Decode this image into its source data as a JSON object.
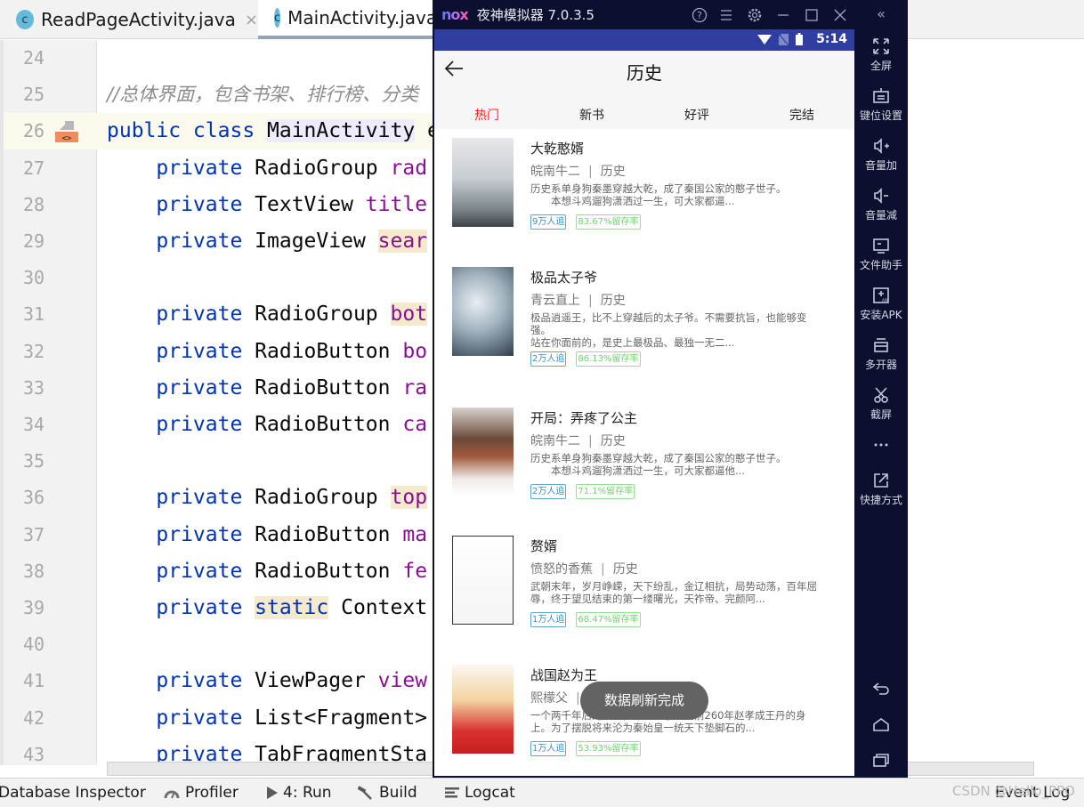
{
  "ide": {
    "tabs": [
      {
        "label": "ReadPageActivity.java",
        "icon": "class-c-icon",
        "active": false,
        "close": "×"
      },
      {
        "label": "MainActivity.java",
        "icon": "class-c-icon",
        "active": true
      }
    ],
    "code_lines": [
      {
        "num": "24",
        "segments": []
      },
      {
        "num": "25",
        "segments": [
          {
            "t": "//总体界面，包含书架、排行榜、分类",
            "c": "cmt"
          }
        ]
      },
      {
        "num": "26",
        "segments": [
          {
            "t": "public class ",
            "c": "kw"
          },
          {
            "t": "MainActivity",
            "c": "hl-lav"
          },
          {
            "t": " e",
            "c": ""
          }
        ]
      },
      {
        "num": "27",
        "segments": [
          {
            "t": "    private ",
            "c": "kw"
          },
          {
            "t": "RadioGroup ",
            "c": ""
          },
          {
            "t": "rad",
            "c": "fld"
          }
        ]
      },
      {
        "num": "28",
        "segments": [
          {
            "t": "    private ",
            "c": "kw"
          },
          {
            "t": "TextView ",
            "c": ""
          },
          {
            "t": "title",
            "c": "fld"
          }
        ]
      },
      {
        "num": "29",
        "segments": [
          {
            "t": "    private ",
            "c": "kw"
          },
          {
            "t": "ImageView ",
            "c": ""
          },
          {
            "t": "sear",
            "c": "fld hl-yellow"
          }
        ]
      },
      {
        "num": "30",
        "segments": []
      },
      {
        "num": "31",
        "segments": [
          {
            "t": "    private ",
            "c": "kw"
          },
          {
            "t": "RadioGroup ",
            "c": ""
          },
          {
            "t": "bot",
            "c": "fld hl-yellow"
          }
        ]
      },
      {
        "num": "32",
        "segments": [
          {
            "t": "    private ",
            "c": "kw"
          },
          {
            "t": "RadioButton ",
            "c": ""
          },
          {
            "t": "bo",
            "c": "fld"
          }
        ]
      },
      {
        "num": "33",
        "segments": [
          {
            "t": "    private ",
            "c": "kw"
          },
          {
            "t": "RadioButton ",
            "c": ""
          },
          {
            "t": "ra",
            "c": "fld"
          }
        ]
      },
      {
        "num": "34",
        "segments": [
          {
            "t": "    private ",
            "c": "kw"
          },
          {
            "t": "RadioButton ",
            "c": ""
          },
          {
            "t": "ca",
            "c": "fld"
          }
        ]
      },
      {
        "num": "35",
        "segments": []
      },
      {
        "num": "36",
        "segments": [
          {
            "t": "    private ",
            "c": "kw"
          },
          {
            "t": "RadioGroup ",
            "c": ""
          },
          {
            "t": "top",
            "c": "fld hl-yellow"
          }
        ]
      },
      {
        "num": "37",
        "segments": [
          {
            "t": "    private ",
            "c": "kw"
          },
          {
            "t": "RadioButton ",
            "c": ""
          },
          {
            "t": "ma",
            "c": "fld"
          }
        ]
      },
      {
        "num": "38",
        "segments": [
          {
            "t": "    private ",
            "c": "kw"
          },
          {
            "t": "RadioButton ",
            "c": ""
          },
          {
            "t": "fe",
            "c": "fld"
          }
        ]
      },
      {
        "num": "39",
        "segments": [
          {
            "t": "    private ",
            "c": "kw"
          },
          {
            "t": "static",
            "c": "kw hl-yellow"
          },
          {
            "t": " Context",
            "c": ""
          }
        ]
      },
      {
        "num": "40",
        "segments": []
      },
      {
        "num": "41",
        "segments": [
          {
            "t": "    private ",
            "c": "kw"
          },
          {
            "t": "ViewPager ",
            "c": ""
          },
          {
            "t": "view",
            "c": "fld"
          }
        ]
      },
      {
        "num": "42",
        "segments": [
          {
            "t": "    private ",
            "c": "kw"
          },
          {
            "t": "List<Fragment>",
            "c": ""
          }
        ]
      },
      {
        "num": "43",
        "segments": [
          {
            "t": "    private ",
            "c": "kw"
          },
          {
            "t": "TabFragmentSta",
            "c": ""
          }
        ]
      }
    ],
    "statusbar": {
      "items": [
        {
          "label": "Database Inspector",
          "icon": ""
        },
        {
          "label": "Profiler",
          "icon": "gauge-icon"
        },
        {
          "label": "4: Run",
          "icon": "play-icon"
        },
        {
          "label": "Build",
          "icon": "hammer-icon"
        },
        {
          "label": "Logcat",
          "icon": "logcat-icon"
        }
      ],
      "event_log": "Event Log",
      "watermark": "CSDN @Hello_PPO"
    }
  },
  "emulator": {
    "title": "夜神模拟器 7.0.3.5",
    "logo": "nox",
    "window_controls": [
      "help-icon",
      "menu-icon",
      "settings-icon",
      "minimize-icon",
      "maximize-icon",
      "close-icon"
    ],
    "status_time": "5:14",
    "app": {
      "title": "历史",
      "tabs": [
        {
          "label": "热门",
          "active": true
        },
        {
          "label": "新书",
          "active": false
        },
        {
          "label": "好评",
          "active": false
        },
        {
          "label": "完结",
          "active": false
        }
      ],
      "accent_color": "#ff2222",
      "books": [
        {
          "title": "大乾憨婿",
          "author": "皖南牛二",
          "category": "历史",
          "sep": "|",
          "desc": "历史系单身狗秦墨穿越大乾，成了秦国公家的憨子世子。\n　　本想斗鸡遛狗潇洒过一生，可大家都逼...",
          "followers": "9万人追",
          "retention": "83.67%留存率"
        },
        {
          "title": "极品太子爷",
          "author": "青云直上",
          "category": "历史",
          "sep": "|",
          "desc": "极品逍遥王，比不上穿越后的太子爷。不需要抗旨，也能够变强。\n站在你面前的，是史上最极品、最独一无二...",
          "followers": "2万人追",
          "retention": "86.13%留存率"
        },
        {
          "title": "开局：弄疼了公主",
          "author": "皖南牛二",
          "category": "历史",
          "sep": "|",
          "desc": "历史系单身狗秦墨穿越大乾，成了秦国公家的憨子世子。\n　　本想斗鸡遛狗潇洒过一生，可大家都逼他...",
          "followers": "2万人追",
          "retention": "71.1%留存率"
        },
        {
          "title": "赘婿",
          "author": "愤怒的香蕉",
          "category": "历史",
          "sep": "|",
          "desc": "武朝末年，岁月峥嵘，天下纷乱，金辽相抗，局势动荡，百年屈辱，终于望见结束的第一缕曙光，天祚帝、完颜阿...",
          "followers": "1万人追",
          "retention": "68.47%留存率"
        },
        {
          "title": "战国赵为王",
          "author": "熙檬父",
          "category": "历史",
          "sep": "|",
          "desc": "一个两千年后的灵魂，穿越到了公元前260年赵孝成王丹的身上。为了摆脱将来沦为秦始皇一统天下垫脚石的...",
          "followers": "1万人追",
          "retention": "53.93%留存率"
        }
      ],
      "toast": "数据刷新完成"
    },
    "sidebar": {
      "collapse": "«",
      "items": [
        {
          "label": "全屏",
          "icon": "fullscreen-icon"
        },
        {
          "label": "键位设置",
          "icon": "keyboard-icon"
        },
        {
          "label": "音量加",
          "icon": "volume-up-icon"
        },
        {
          "label": "音量减",
          "icon": "volume-down-icon"
        },
        {
          "label": "文件助手",
          "icon": "file-helper-icon"
        },
        {
          "label": "安装APK",
          "icon": "install-apk-icon"
        },
        {
          "label": "多开器",
          "icon": "multi-instance-icon"
        },
        {
          "label": "截屏",
          "icon": "screenshot-icon"
        },
        {
          "label": "···",
          "icon": "more-icon"
        },
        {
          "label": "快捷方式",
          "icon": "shortcut-icon"
        }
      ],
      "nav": [
        "back-icon",
        "home-icon",
        "recents-icon"
      ]
    }
  }
}
